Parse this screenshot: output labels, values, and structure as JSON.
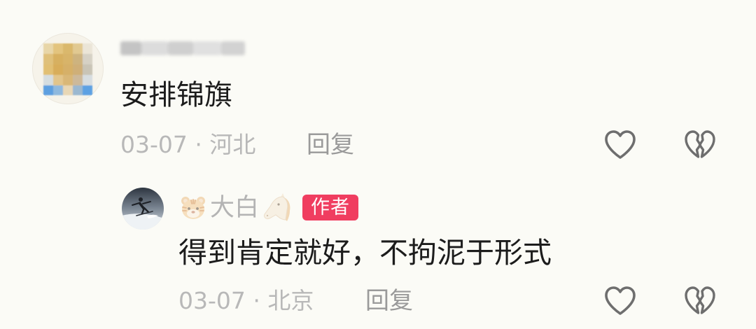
{
  "colors": {
    "background": "#fbfbf6",
    "text_primary": "#1c1c1c",
    "meta": "#b8b8b8",
    "reply": "#9a9a9a",
    "username": "#b4b4b4",
    "badge_bg": "#f03d60",
    "badge_text": "#ffffff",
    "icon_stroke": "#6e6e6e"
  },
  "comment": {
    "avatar_icon": "blurred-user-avatar",
    "username_icon": "blurred-username",
    "text": "安排锦旗",
    "meta": "03-07 · 河北",
    "reply_label": "回复",
    "like_icon": "heart-outline-icon",
    "dislike_icon": "broken-heart-icon"
  },
  "reply": {
    "avatar_icon": "skier-photo-avatar",
    "username_prefix_emoji": "tiger-face-emoji",
    "username": "大白",
    "username_suffix_emoji": "horse-face-emoji",
    "author_badge": "作者",
    "text": "得到肯定就好，不拘泥于形式",
    "meta": "03-07 · 北京",
    "reply_label": "回复",
    "like_icon": "heart-outline-icon",
    "dislike_icon": "broken-heart-icon"
  }
}
